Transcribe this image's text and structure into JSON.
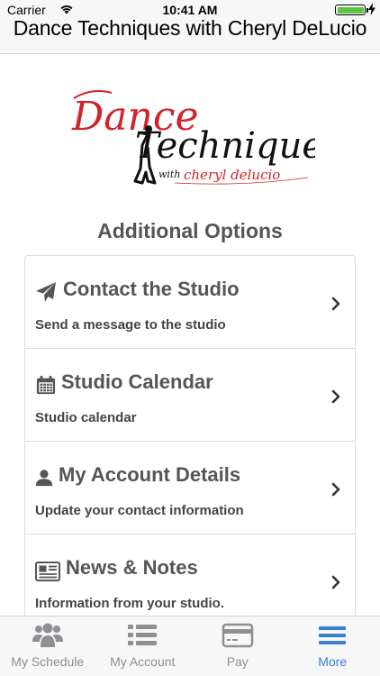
{
  "status_bar": {
    "carrier": "Carrier",
    "time": "10:41 AM",
    "battery_level": 1.0
  },
  "nav": {
    "title": "Dance Techniques with Cheryl DeLucio"
  },
  "logo": {
    "text_line1": "Dance",
    "text_line2": "Techniques",
    "with": "with",
    "name": "cheryl delucio",
    "colors": {
      "red": "#d3232a",
      "black": "#111111"
    }
  },
  "main": {
    "section_title": "Additional Options",
    "options": [
      {
        "icon": "paper-plane-icon",
        "title": "Contact the Studio",
        "subtitle": "Send a message to the studio"
      },
      {
        "icon": "calendar-icon",
        "title": "Studio Calendar",
        "subtitle": "Studio calendar"
      },
      {
        "icon": "user-icon",
        "title": "My Account Details",
        "subtitle": "Update your contact information"
      },
      {
        "icon": "newspaper-icon",
        "title": "News & Notes",
        "subtitle": "Information from your studio."
      }
    ]
  },
  "tabs": [
    {
      "icon": "users-icon",
      "label": "My Schedule",
      "active": false
    },
    {
      "icon": "list-icon",
      "label": "My Account",
      "active": false
    },
    {
      "icon": "credit-card-icon",
      "label": "Pay",
      "active": false
    },
    {
      "icon": "menu-icon",
      "label": "More",
      "active": true
    }
  ],
  "colors": {
    "accent": "#3a7fd0",
    "inactive": "#8e8e93",
    "text": "#555555",
    "battery": "#5dc543"
  }
}
